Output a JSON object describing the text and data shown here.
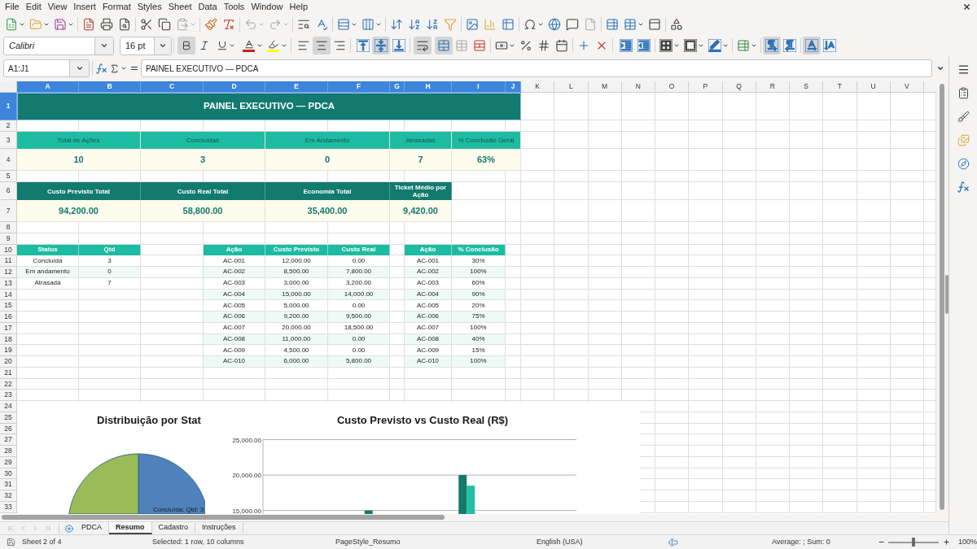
{
  "menu_bar": [
    "File",
    "Edit",
    "View",
    "Insert",
    "Format",
    "Styles",
    "Sheet",
    "Data",
    "Tools",
    "Window",
    "Help"
  ],
  "standard_toolbar": {
    "paste_disabled": true,
    "undo_disabled": true,
    "redo_disabled": true,
    "headers_footers_disabled": true
  },
  "formatting_toolbar": {
    "font_name": "Calibri",
    "font_size": "16 pt",
    "bold": true,
    "italic": false,
    "underline": false,
    "align_left": false,
    "align_center": true,
    "align_right": false,
    "align_top": false,
    "align_middle": true,
    "align_bottom": false,
    "wrap_text": true,
    "merge_and_center": true,
    "merge_cells_disabled": true,
    "left_to_right": true,
    "right_to_left": false,
    "text_horizontal": true,
    "text_vertical": false
  },
  "formula_bar": {
    "name_box": "A1:J1",
    "formula": "PAINEL EXECUTIVO — PDCA"
  },
  "columns": [
    {
      "label": "A",
      "selected": true
    },
    {
      "label": "B",
      "selected": true
    },
    {
      "label": "C",
      "selected": true
    },
    {
      "label": "D",
      "selected": true
    },
    {
      "label": "E",
      "selected": true
    },
    {
      "label": "F",
      "selected": true
    },
    {
      "label": "G",
      "selected": true
    },
    {
      "label": "H",
      "selected": true
    },
    {
      "label": "I",
      "selected": true
    },
    {
      "label": "J",
      "selected": true
    },
    {
      "label": "K",
      "selected": false
    },
    {
      "label": "L",
      "selected": false
    },
    {
      "label": "M",
      "selected": false
    },
    {
      "label": "N",
      "selected": false
    },
    {
      "label": "O",
      "selected": false
    },
    {
      "label": "P",
      "selected": false
    },
    {
      "label": "Q",
      "selected": false
    },
    {
      "label": "R",
      "selected": false
    },
    {
      "label": "S",
      "selected": false
    },
    {
      "label": "T",
      "selected": false
    },
    {
      "label": "U",
      "selected": false
    },
    {
      "label": "V",
      "selected": false
    }
  ],
  "rows": [
    {
      "label": "1",
      "selected": true
    },
    {
      "label": "2",
      "selected": false
    },
    {
      "label": "3",
      "selected": false
    },
    {
      "label": "4",
      "selected": false
    },
    {
      "label": "5",
      "selected": false
    },
    {
      "label": "6",
      "selected": false
    },
    {
      "label": "7",
      "selected": false
    },
    {
      "label": "8",
      "selected": false
    },
    {
      "label": "9",
      "selected": false
    },
    {
      "label": "10",
      "selected": false
    },
    {
      "label": "11",
      "selected": false
    },
    {
      "label": "12",
      "selected": false
    },
    {
      "label": "13",
      "selected": false
    },
    {
      "label": "14",
      "selected": false
    },
    {
      "label": "15",
      "selected": false
    },
    {
      "label": "16",
      "selected": false
    },
    {
      "label": "17",
      "selected": false
    },
    {
      "label": "18",
      "selected": false
    },
    {
      "label": "19",
      "selected": false
    },
    {
      "label": "20",
      "selected": false
    },
    {
      "label": "21",
      "selected": false
    },
    {
      "label": "22",
      "selected": false
    },
    {
      "label": "23",
      "selected": false
    },
    {
      "label": "24",
      "selected": false
    },
    {
      "label": "25",
      "selected": false
    },
    {
      "label": "26",
      "selected": false
    },
    {
      "label": "27",
      "selected": false
    },
    {
      "label": "28",
      "selected": false
    },
    {
      "label": "29",
      "selected": false
    },
    {
      "label": "30",
      "selected": false
    },
    {
      "label": "31",
      "selected": false
    },
    {
      "label": "32",
      "selected": false
    },
    {
      "label": "33",
      "selected": false
    }
  ],
  "sheet": {
    "title": {
      "text": "PAINEL EXECUTIVO — PDCA",
      "selected": true
    },
    "kpis": [
      {
        "label": "Total de Ações",
        "value": "10"
      },
      {
        "label": "Concluídas",
        "value": "3"
      },
      {
        "label": "Em Andamento",
        "value": "0"
      },
      {
        "label": "Atrasadas",
        "value": "7"
      },
      {
        "label": "% Conclusão Geral",
        "value": "63%"
      }
    ],
    "cost_kpis": [
      {
        "label": "Custo Previsto Total",
        "value": "94,200.00"
      },
      {
        "label": "Custo Real Total",
        "value": "58,800.00"
      },
      {
        "label": "Economia Total",
        "value": "35,400.00"
      },
      {
        "label": "Ticket Médio por Ação",
        "value": "9,420.00"
      }
    ],
    "status_table": {
      "columns": [
        "Status",
        "Qtd"
      ],
      "rows": [
        [
          "Concluída",
          "3"
        ],
        [
          "Em andamento",
          "0"
        ],
        [
          "Atrasada",
          "7"
        ]
      ]
    },
    "cost_table": {
      "columns": [
        "Ação",
        "Custo Previsto",
        "Custo Real"
      ],
      "rows": [
        [
          "AC-001",
          "12,000.00",
          "0.00"
        ],
        [
          "AC-002",
          "8,500.00",
          "7,800.00"
        ],
        [
          "AC-003",
          "3,000.00",
          "3,200.00"
        ],
        [
          "AC-004",
          "15,000.00",
          "14,000.00"
        ],
        [
          "AC-005",
          "5,000.00",
          "0.00"
        ],
        [
          "AC-006",
          "9,200.00",
          "9,500.00"
        ],
        [
          "AC-007",
          "20,000.00",
          "18,500.00"
        ],
        [
          "AC-008",
          "11,000.00",
          "0.00"
        ],
        [
          "AC-009",
          "4,500.00",
          "0.00"
        ],
        [
          "AC-010",
          "6,000.00",
          "5,800.00"
        ]
      ]
    },
    "progress_table": {
      "columns": [
        "Ação",
        "% Conclusão"
      ],
      "rows": [
        [
          "AC-001",
          "30%"
        ],
        [
          "AC-002",
          "100%"
        ],
        [
          "AC-003",
          "60%"
        ],
        [
          "AC-004",
          "90%"
        ],
        [
          "AC-005",
          "20%"
        ],
        [
          "AC-006",
          "75%"
        ],
        [
          "AC-007",
          "100%"
        ],
        [
          "AC-008",
          "40%"
        ],
        [
          "AC-009",
          "15%"
        ],
        [
          "AC-010",
          "100%"
        ]
      ]
    }
  },
  "pie_chart": {
    "title": "Distribuição por Stat",
    "data_label": "Concluída; Qtd: 3"
  },
  "bar_chart": {
    "chart_data": {
      "type": "bar",
      "title": "Custo Previsto vs Custo Real (R$)",
      "ylim": [
        14500,
        25000
      ],
      "yticks": [
        {
          "value": 15000,
          "label": "15,000.00"
        },
        {
          "value": 20000,
          "label": "20,000.00"
        },
        {
          "value": 25000,
          "label": "25,000.00"
        }
      ],
      "series": [
        {
          "color": "#137a6c",
          "values": [
            null,
            null,
            null,
            15000,
            null,
            null,
            20000,
            null,
            null,
            null
          ]
        },
        {
          "color": "#22c0a7",
          "values": [
            null,
            null,
            null,
            null,
            null,
            null,
            18500,
            null,
            null,
            null
          ]
        }
      ]
    }
  },
  "sheet_tabs": {
    "navigation_disabled": true,
    "tabs": [
      {
        "label": "PDCA",
        "selected": false
      },
      {
        "label": "Resumo",
        "selected": true
      },
      {
        "label": "Cadastro",
        "selected": false
      },
      {
        "label": "Instruções",
        "selected": false
      }
    ]
  },
  "status_bar": {
    "sheet_position": "Sheet 2 of 4",
    "selection": "Selected: 1 row, 10 columns",
    "page_style": "PageStyle_Resumo",
    "language": "English (USA)",
    "summary": "Average: ; Sum: 0",
    "zoom": {
      "level": 0.5,
      "reading": "100%"
    }
  }
}
